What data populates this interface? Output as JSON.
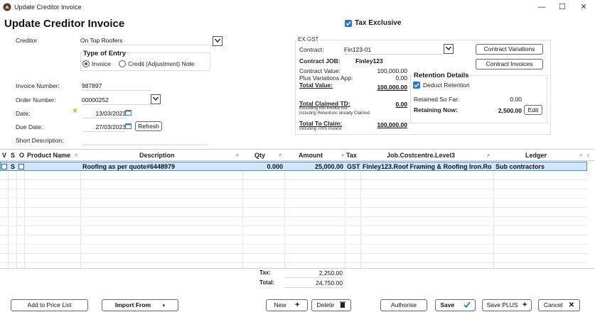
{
  "window": {
    "title": "Update Creditor Invoice",
    "minimize": "—",
    "maximize": "☐",
    "close": "✕"
  },
  "form": {
    "title": "Update Creditor Invoice"
  },
  "tax_exclusive": {
    "label": "Tax Exclusive",
    "checked": true
  },
  "creditor": {
    "label": "Creditor",
    "value": "On Top Roofers"
  },
  "type_of_entry": {
    "heading": "Type of Entry",
    "options": [
      "Invoice",
      "Credit (Adjustment) Note"
    ],
    "selected": "Invoice"
  },
  "invoice_number": {
    "label": "Invoice Number:",
    "value": "987897"
  },
  "order_number": {
    "label": "Order Number:",
    "value": "00000252"
  },
  "date": {
    "label": "Date:",
    "value": "13/03/2023"
  },
  "due_date": {
    "label": "Due Date:",
    "value": "27/03/2023",
    "refresh_label": "Refresh"
  },
  "short_description": {
    "label": "Short Description:",
    "value": ""
  },
  "ex_gst": {
    "heading": "EX GST",
    "contract_label": "Contract:",
    "contract_value": "Fin123-01",
    "contract_job_label": "Contract JOB:",
    "contract_job_value": "Finley123",
    "contract_value_label": "Contract Value:",
    "contract_value_amount": "100,000.00",
    "plus_variations_label": "Plus Variations App:",
    "plus_variations_amount": "0.00",
    "total_value_label": "Total Value:",
    "total_value_amount": "100,000.00",
    "total_claimed_label": "Total Claimed TD:",
    "total_claimed_note1": "Excluding this invoice but",
    "total_claimed_note2": "including Retentions already Claimed",
    "total_claimed_amount": "0.00",
    "total_to_claim_label": "Total To Claim:",
    "total_to_claim_note": "Including THIS invoice",
    "total_to_claim_amount": "100,000.00",
    "contract_variations_button": "Contract Variations",
    "contract_invoices_button": "Contract Invoices"
  },
  "retention": {
    "heading": "Retention Details",
    "deduct_label": "Deduct Retention",
    "deduct_checked": true,
    "retained_so_far_label": "Retained So Far:",
    "retained_so_far_value": "0.00",
    "retaining_now_label": "Retaining Now:",
    "retaining_now_value": "2,500.00",
    "edit_label": "Edit"
  },
  "grid": {
    "columns": [
      "V",
      "S",
      "O",
      "Product Name",
      "Description",
      "Qty",
      "Amount",
      "Tax",
      "Job.Costcentre.Level3",
      "Ledger"
    ],
    "rows": [
      {
        "v": "",
        "s": "S",
        "o": "",
        "product_name": "",
        "description": "Roofing as per quote#6448979",
        "qty": "0.000",
        "amount": "25,000.00",
        "tax": "GST",
        "job": "Finley123.Roof Framing & Roofing Iron.Ro",
        "ledger": "Sub contractors"
      }
    ]
  },
  "totals": {
    "tax_label": "Tax:",
    "tax_value": "2,250.00",
    "total_label": "Total:",
    "total_value": "24,750.00"
  },
  "buttons": {
    "add_to_price_list": "Add to Price List",
    "import_from": "Import From",
    "new": "New",
    "delete": "Delete",
    "authorise": "Authorise",
    "save": "Save",
    "save_plus": "Save PLUS",
    "cancel": "Cancel"
  },
  "colors": {
    "accent_blue": "#2a74c9",
    "row_highlight": "#d4e6fb",
    "save_check": "#2a74c9"
  }
}
